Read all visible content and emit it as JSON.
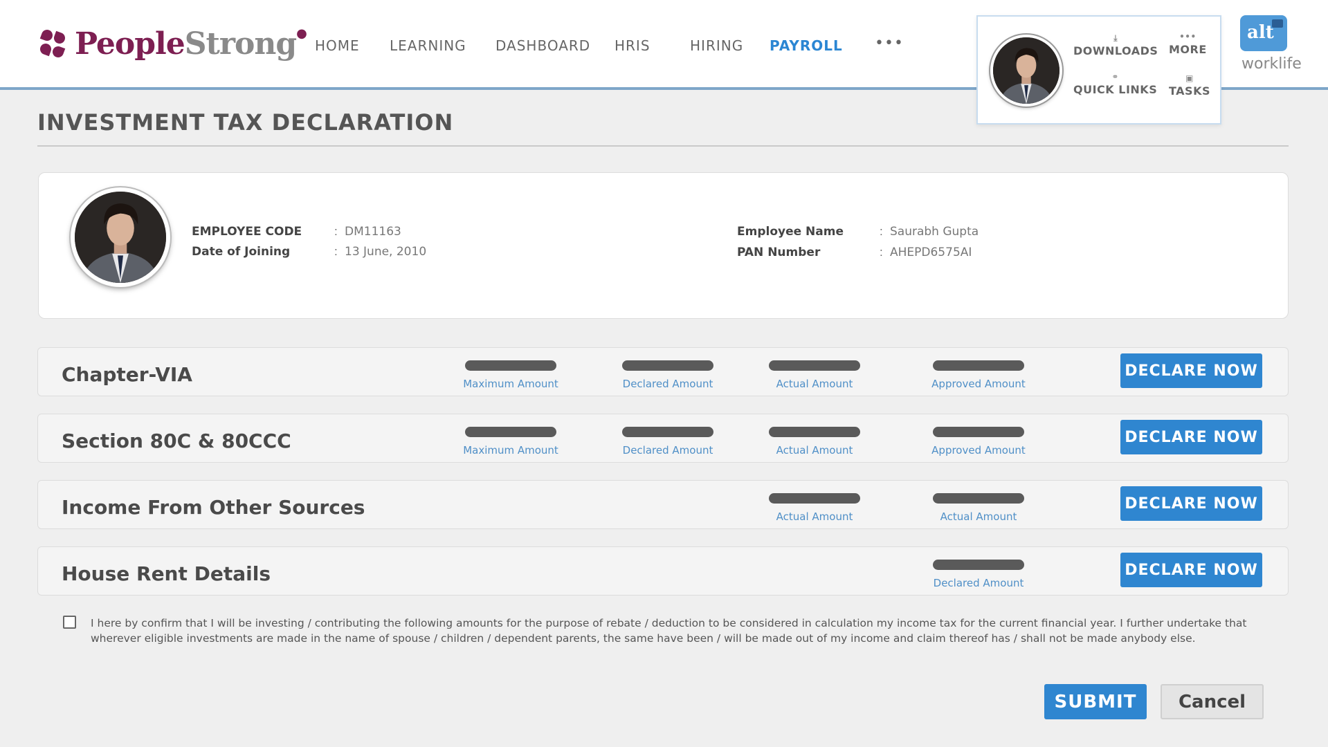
{
  "header": {
    "logo_primary": "People",
    "logo_secondary": "Strong",
    "nav": [
      "HOME",
      "LEARNING",
      "DASHBOARD",
      "HRIS",
      "HIRING",
      "PAYROLL"
    ],
    "active_nav": "PAYROLL",
    "more_dots": "•••",
    "quick": {
      "downloads": "DOWNLOADS",
      "more": "MORE",
      "quick_links": "QUICK LINKS",
      "tasks": "TASKS"
    },
    "brand_alt": "alt",
    "brand_worklife": "worklife"
  },
  "page": {
    "title": "INVESTMENT TAX DECLARATION"
  },
  "employee": {
    "code_label": "EMPLOYEE CODE",
    "code": "DM11163",
    "doj_label": "Date of Joining",
    "doj": "13 June, 2010",
    "name_label": "Employee Name",
    "name": "Saurabh Gupta",
    "pan_label": "PAN Number",
    "pan": "AHEPD6575AI",
    "colon": ":"
  },
  "sections": [
    {
      "title": "Chapter-VIA",
      "metrics": [
        "Maximum Amount",
        "Declared Amount",
        "Actual Amount",
        "Approved Amount"
      ],
      "button": "DECLARE NOW"
    },
    {
      "title": "Section 80C & 80CCC",
      "metrics": [
        "Maximum Amount",
        "Declared Amount",
        "Actual Amount",
        "Approved Amount"
      ],
      "button": "DECLARE NOW"
    },
    {
      "title": "Income From Other Sources",
      "metrics": [
        "Actual Amount",
        "Actual Amount"
      ],
      "button": "DECLARE NOW"
    },
    {
      "title": "House Rent Details",
      "metrics": [
        "Declared Amount"
      ],
      "button": "DECLARE NOW"
    }
  ],
  "confirmation": {
    "checked": false,
    "text": "I here by confirm that I will be investing / contributing the following amounts for the purpose of rebate /  deduction to be considered in calculation my income tax for the current financial year.  I further undertake that wherever eligible investments are made in the name of spouse / children / dependent parents, the same have been / will be made out of my income and claim thereof has / shall not be made anybody else."
  },
  "actions": {
    "submit": "SUBMIT",
    "cancel": "Cancel"
  },
  "colors": {
    "brand": "#7d1f52",
    "accent": "#2f86d0",
    "metric_label": "#4f8fc7"
  }
}
